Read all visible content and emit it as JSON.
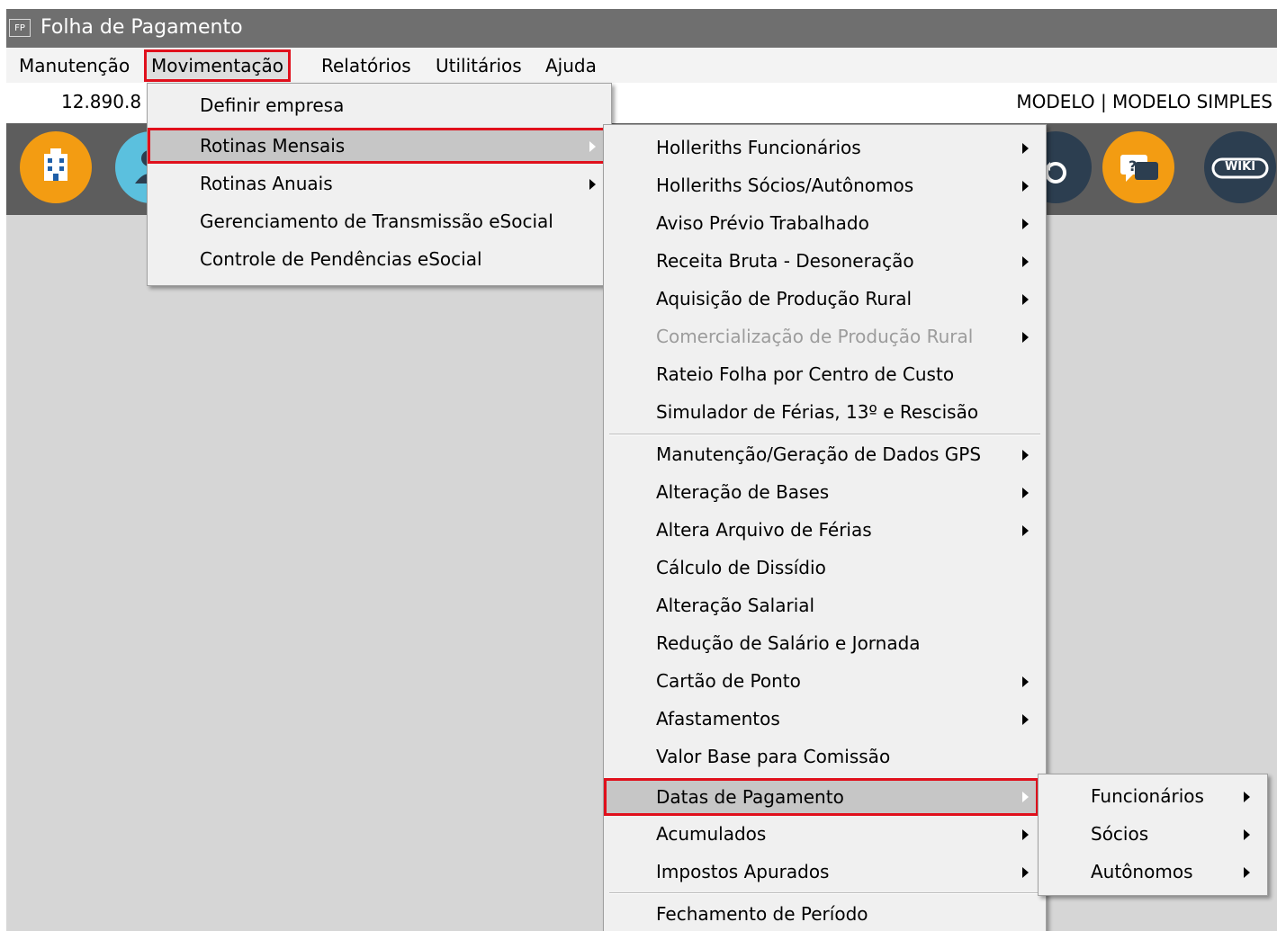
{
  "window": {
    "icon_label": "FP",
    "title": "Folha de Pagamento"
  },
  "menubar": {
    "items": [
      {
        "label": "Manutenção"
      },
      {
        "label": "Movimentação"
      },
      {
        "label": "Relatórios"
      },
      {
        "label": "Utilitários"
      },
      {
        "label": "Ajuda"
      }
    ]
  },
  "infobar": {
    "cnpj": "12.890.8",
    "company": "MODELO | MODELO SIMPLES"
  },
  "toolbar": {
    "buttons": [
      {
        "icon": "building-icon",
        "color": "#f39c12"
      },
      {
        "icon": "person-icon",
        "color": "#5bc0de"
      },
      {
        "icon": "refresh-icon",
        "color": "#2c3e50"
      },
      {
        "icon": "chat-help-icon",
        "color": "#f39c12"
      },
      {
        "icon": "wiki-icon",
        "color": "#2c3e50",
        "label": "WIKI"
      }
    ]
  },
  "movimentacao_menu": {
    "items": [
      {
        "label": "Definir empresa"
      },
      {
        "label": "Rotinas Mensais"
      },
      {
        "label": "Rotinas Anuais"
      },
      {
        "label": "Gerenciamento de Transmissão eSocial"
      },
      {
        "label": "Controle de Pendências eSocial"
      }
    ]
  },
  "rotinas_mensais_menu": {
    "items": [
      {
        "label": "Holleriths Funcionários"
      },
      {
        "label": "Holleriths Sócios/Autônomos"
      },
      {
        "label": "Aviso Prévio Trabalhado"
      },
      {
        "label": "Receita Bruta - Desoneração"
      },
      {
        "label": "Aquisição de Produção Rural"
      },
      {
        "label": "Comercialização de Produção Rural"
      },
      {
        "label": "Rateio Folha por Centro de Custo"
      },
      {
        "label": "Simulador de Férias, 13º e Rescisão"
      },
      {
        "label": "Manutenção/Geração de Dados GPS"
      },
      {
        "label": "Alteração de Bases"
      },
      {
        "label": "Altera Arquivo de Férias"
      },
      {
        "label": "Cálculo de Dissídio"
      },
      {
        "label": "Alteração Salarial"
      },
      {
        "label": "Redução de Salário e Jornada"
      },
      {
        "label": "Cartão de Ponto"
      },
      {
        "label": "Afastamentos"
      },
      {
        "label": "Valor Base para Comissão"
      },
      {
        "label": "Datas de Pagamento"
      },
      {
        "label": "Acumulados"
      },
      {
        "label": "Impostos Apurados"
      },
      {
        "label": "Fechamento de Período"
      }
    ]
  },
  "datas_pagamento_menu": {
    "items": [
      {
        "label": "Funcionários"
      },
      {
        "label": "Sócios"
      },
      {
        "label": "Autônomos"
      }
    ]
  }
}
